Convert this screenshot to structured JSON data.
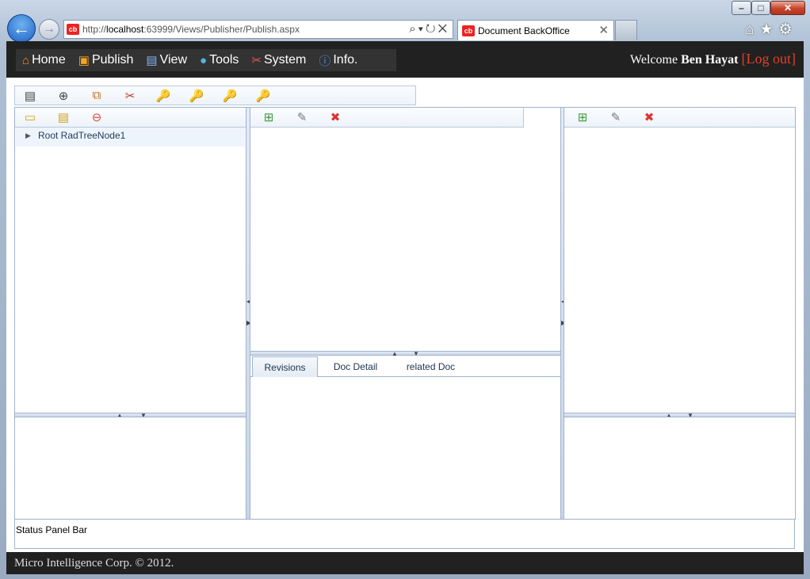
{
  "browser": {
    "url_prefix": "http://",
    "url_host": "localhost",
    "url_rest": ":63999/Views/Publisher/Publish.aspx",
    "tab_title": "Document BackOffice",
    "favicon_text": "cb"
  },
  "menu": {
    "items": [
      {
        "label": "Home",
        "icon": "home-icon"
      },
      {
        "label": "Publish",
        "icon": "publish-icon"
      },
      {
        "label": "View",
        "icon": "view-icon"
      },
      {
        "label": "Tools",
        "icon": "tools-icon"
      },
      {
        "label": "System",
        "icon": "system-icon"
      },
      {
        "label": "Info.",
        "icon": "info-icon"
      }
    ],
    "welcome_text": "Welcome",
    "user_name": "Ben Hayat",
    "logout_label": "[Log out]"
  },
  "tree": {
    "root_label": "Root RadTreeNode1"
  },
  "tabs": {
    "items": [
      "Revisions",
      "Doc Detail",
      "related Doc"
    ],
    "selected": "Revisions"
  },
  "status_bar": "Status Panel Bar",
  "footer": "Micro Intelligence Corp. © 2012."
}
